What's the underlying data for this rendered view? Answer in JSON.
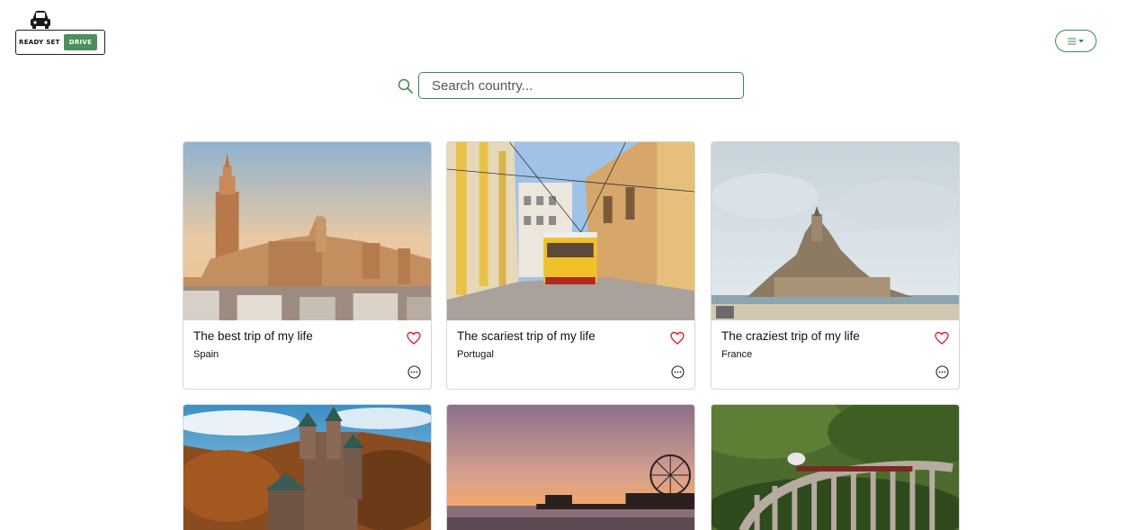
{
  "header": {
    "logo_text": "READY SET",
    "logo_badge": "DRIVE",
    "menu_icon": "hamburger-dropdown-icon"
  },
  "search": {
    "placeholder": "Search country..."
  },
  "colors": {
    "accent_green": "#3a8a4a",
    "heart_red": "#e0202c"
  },
  "cards": [
    {
      "title": "The best trip of my life",
      "country": "Spain",
      "image": "seville-cathedral-photo"
    },
    {
      "title": "The scariest trip of my life",
      "country": "Portugal",
      "image": "lisbon-tram-photo"
    },
    {
      "title": "The craziest trip of my life",
      "country": "France",
      "image": "mont-saint-michel-photo"
    },
    {
      "title": "",
      "country": "",
      "image": "castle-forest-photo"
    },
    {
      "title": "",
      "country": "",
      "image": "pier-sunset-photo"
    },
    {
      "title": "",
      "country": "",
      "image": "viaduct-train-photo"
    }
  ]
}
